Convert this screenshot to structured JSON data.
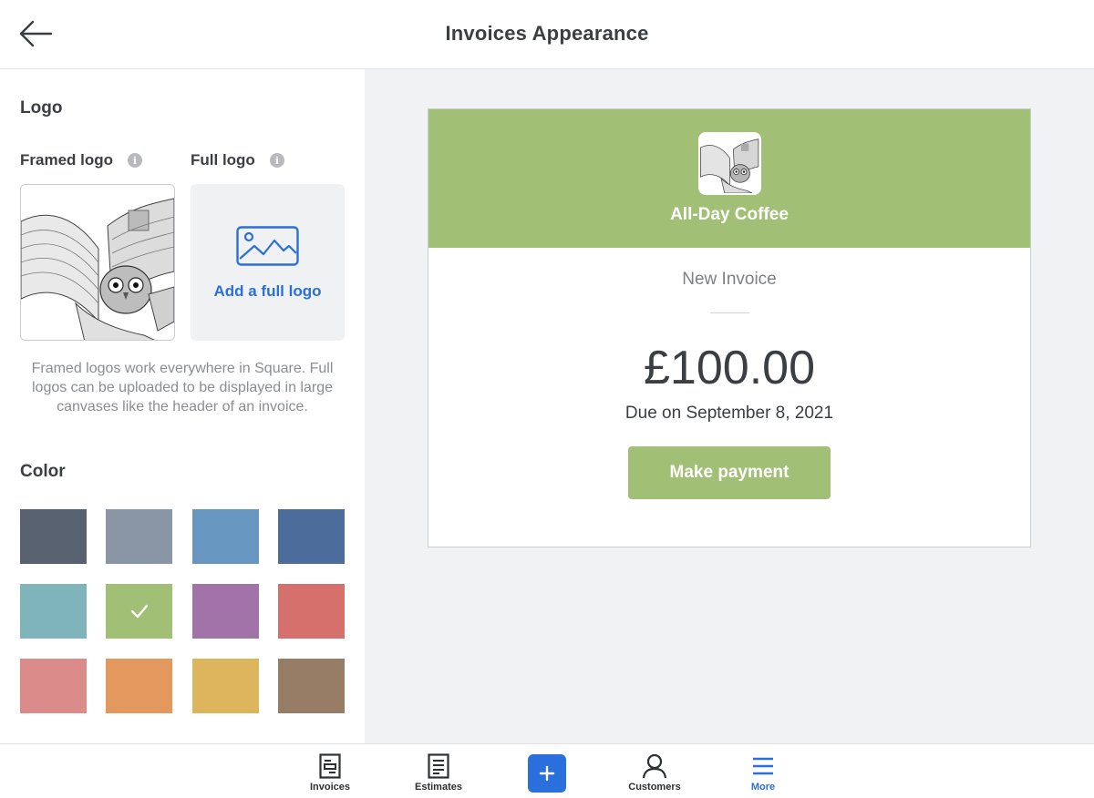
{
  "header": {
    "title": "Invoices Appearance",
    "back_icon": "arrow-left-icon"
  },
  "logo_section": {
    "title": "Logo",
    "framed_logo_label": "Framed logo",
    "full_logo_label": "Full logo",
    "info_glyph": "i",
    "add_full_logo": "Add a full logo",
    "help_text": "Framed logos work everywhere in Square. Full logos can be uploaded to be displayed in large canvases like the header of an invoice."
  },
  "color_section": {
    "title": "Color",
    "selected_index": 5,
    "swatches": [
      "#58616f",
      "#8a96a6",
      "#6796c1",
      "#4c6d9c",
      "#7fb4bb",
      "#a2bf76",
      "#a273a8",
      "#d6706c",
      "#db8b89",
      "#e3985d",
      "#ddb55d",
      "#977d66"
    ]
  },
  "invoice_preview": {
    "business_name": "All-Day Coffee",
    "subtitle": "New Invoice",
    "amount": "£100.00",
    "due": "Due on September 8, 2021",
    "pay_button": "Make payment",
    "accent_color": "#a2bf76"
  },
  "tabbar": {
    "tabs": [
      {
        "label": "Invoices",
        "icon": "invoice-icon"
      },
      {
        "label": "Estimates",
        "icon": "estimate-icon"
      },
      {
        "label": "Customers",
        "icon": "customer-icon"
      },
      {
        "label": "More",
        "icon": "menu-icon",
        "active": true
      }
    ],
    "add_glyph": "+"
  }
}
